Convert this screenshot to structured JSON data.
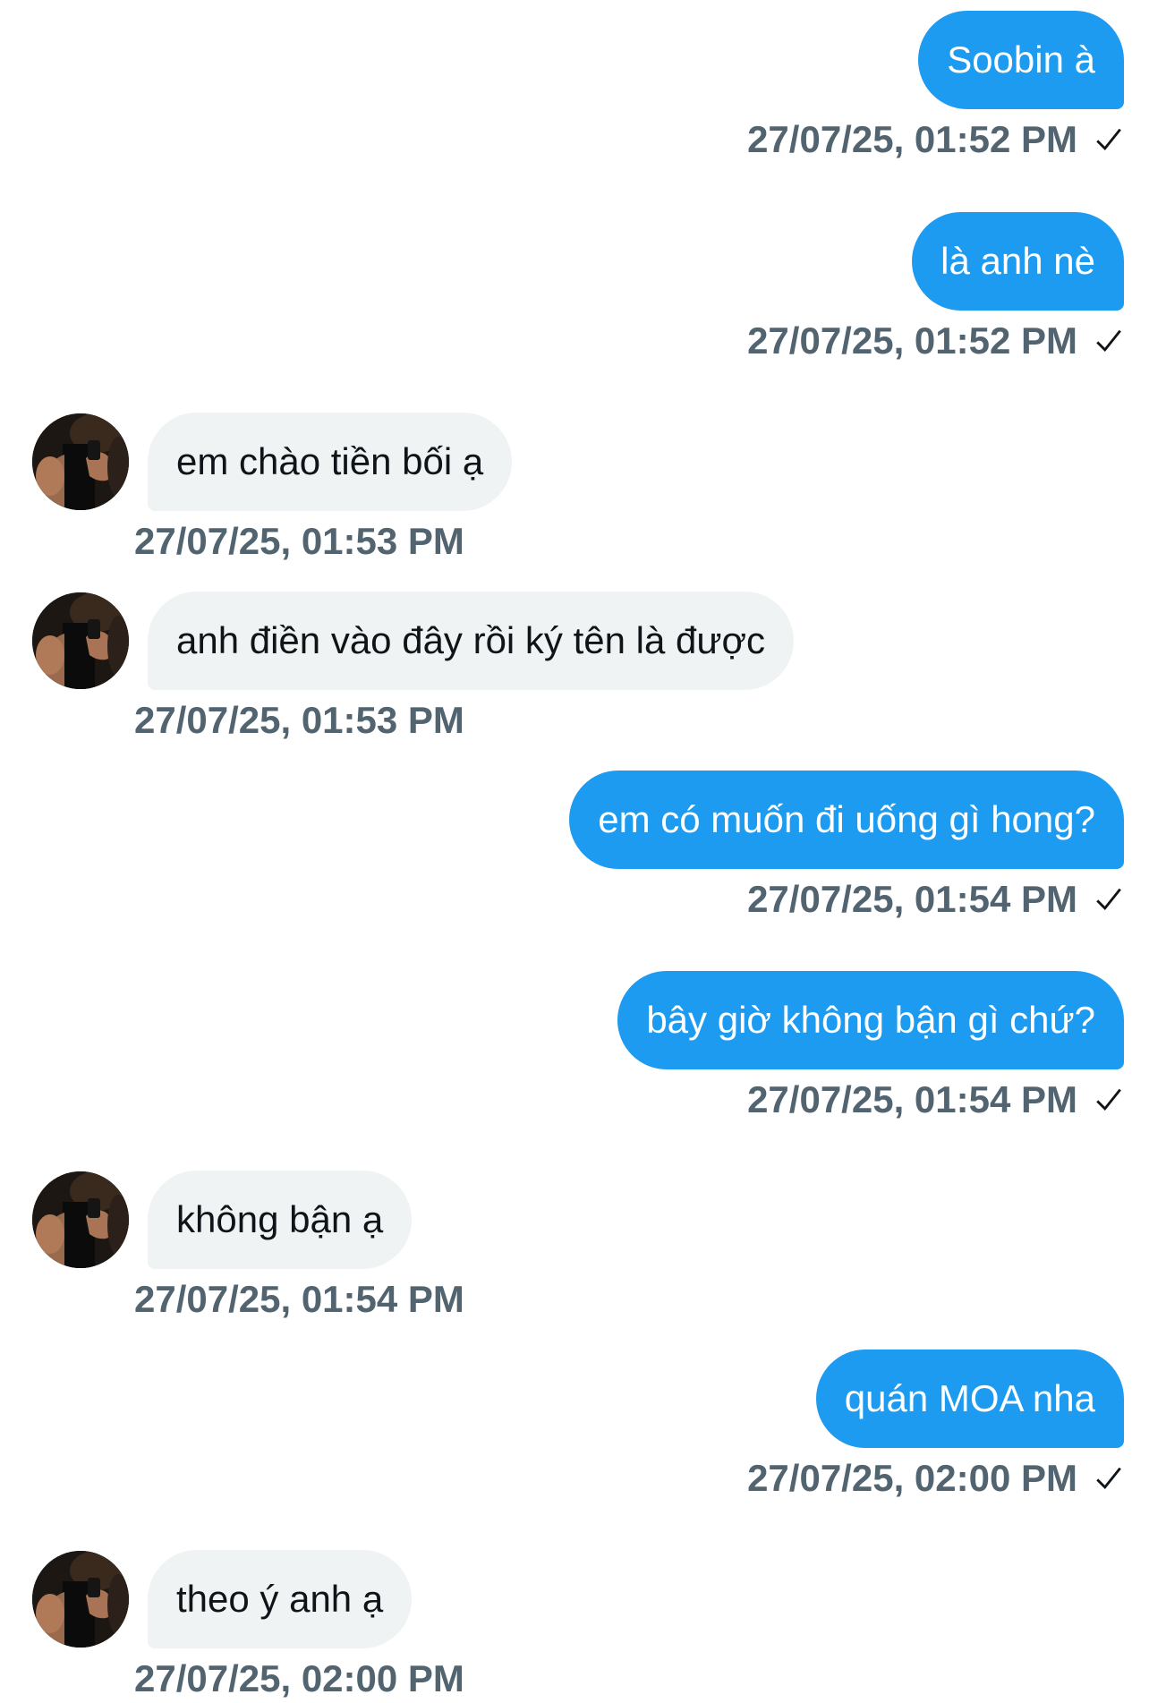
{
  "colors": {
    "outgoing_bubble": "#1d9bf0",
    "incoming_bubble": "#eff3f4",
    "timestamp": "#536471"
  },
  "icons": {
    "sent": "checkmark-icon",
    "avatar": "contact-avatar-photo"
  },
  "messages": [
    {
      "direction": "out",
      "text": "Soobin à",
      "timestamp": "27/07/25, 01:52 PM"
    },
    {
      "direction": "out",
      "text": "là anh nè",
      "timestamp": "27/07/25, 01:52 PM"
    },
    {
      "direction": "in",
      "text": "em chào tiền bối ạ",
      "timestamp": "27/07/25, 01:53 PM"
    },
    {
      "direction": "in",
      "text": "anh điền vào đây rồi ký tên là được",
      "timestamp": "27/07/25, 01:53 PM"
    },
    {
      "direction": "out",
      "text": "em có muốn đi uống gì hong?",
      "timestamp": "27/07/25, 01:54 PM"
    },
    {
      "direction": "out",
      "text": "bây giờ không bận gì chứ?",
      "timestamp": "27/07/25, 01:54 PM"
    },
    {
      "direction": "in",
      "text": "không bận ạ",
      "timestamp": "27/07/25, 01:54 PM"
    },
    {
      "direction": "out",
      "text": "quán MOA nha",
      "timestamp": "27/07/25, 02:00 PM"
    },
    {
      "direction": "in",
      "text": "theo ý anh ạ",
      "timestamp": "27/07/25, 02:00 PM"
    }
  ]
}
